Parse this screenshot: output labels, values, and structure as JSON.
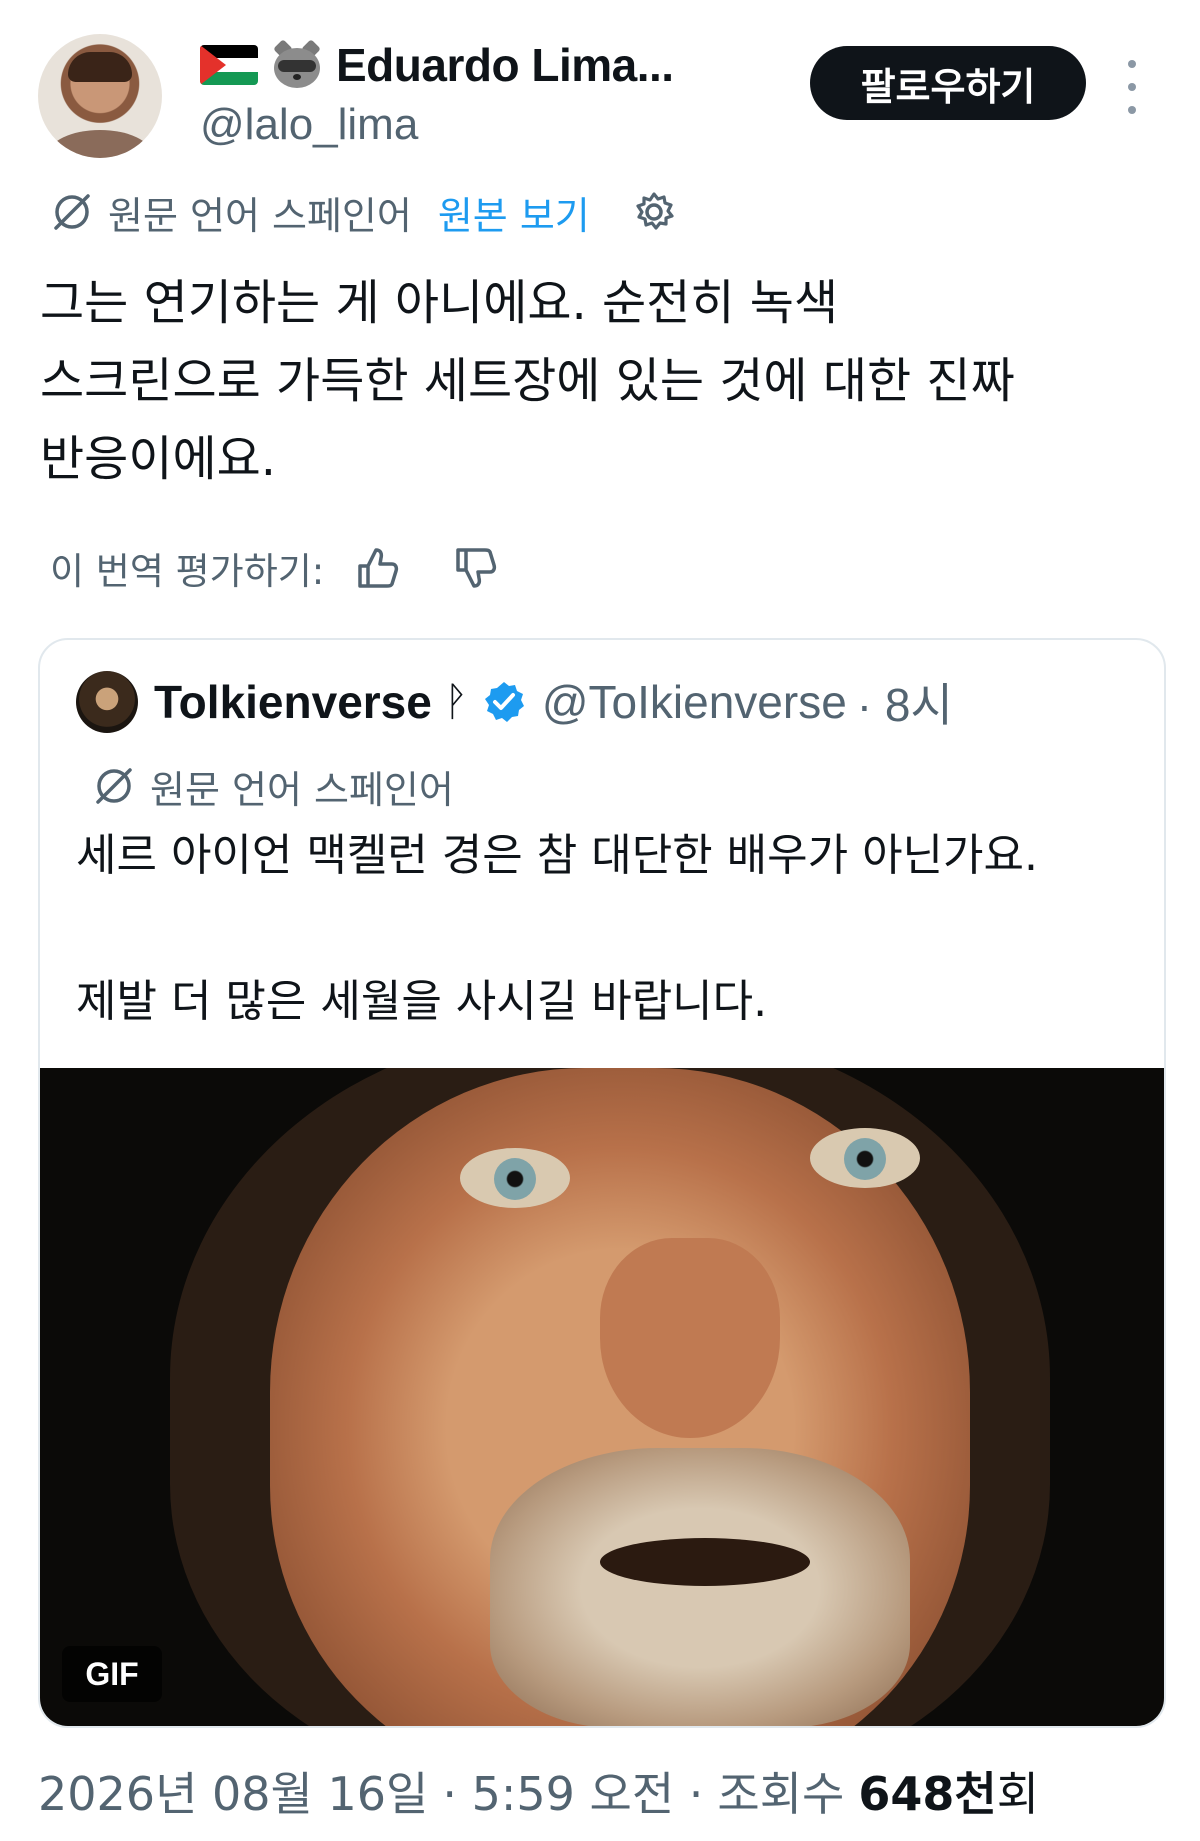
{
  "author": {
    "display_name": "Eduardo Lima...",
    "handle": "@lalo_lima",
    "badges": [
      "palestine-flag-emoji",
      "raccoon-emoji"
    ]
  },
  "follow_button": {
    "label": "팔로우하기"
  },
  "translation": {
    "label": "원문 언어 스페인어",
    "view_original": "원본 보기",
    "rate_label": "이 번역 평가하기:"
  },
  "tweet": {
    "lines": [
      "그는 연기하는 게 아니에요. 순전히 녹색",
      "스크린으로 가득한 세트장에 있는 것에 대한 진짜",
      "반응이에요."
    ]
  },
  "quote": {
    "name": "Tolkienverse",
    "rune": "ᚹ",
    "handle": "@ToIkienverse",
    "time": "· 8시",
    "translation_label": "원문 언어 스페인어",
    "line1": "세르 아이언 맥켈런 경은 참 대단한 배우가 아닌가요.",
    "line2": "제발 더 많은 세월을 사시길 바랍니다.",
    "media_badge": "GIF"
  },
  "meta": {
    "date": "2026년 08월 16일",
    "time": "· 5:59 오전 ·",
    "views_label": "조회수",
    "views_value": "648천",
    "views_unit": "회"
  },
  "colors": {
    "text": "#0f1419",
    "secondary": "#536471",
    "link": "#1d9bf0",
    "verified": "#1d9bf0",
    "button_bg": "#0f1419"
  }
}
